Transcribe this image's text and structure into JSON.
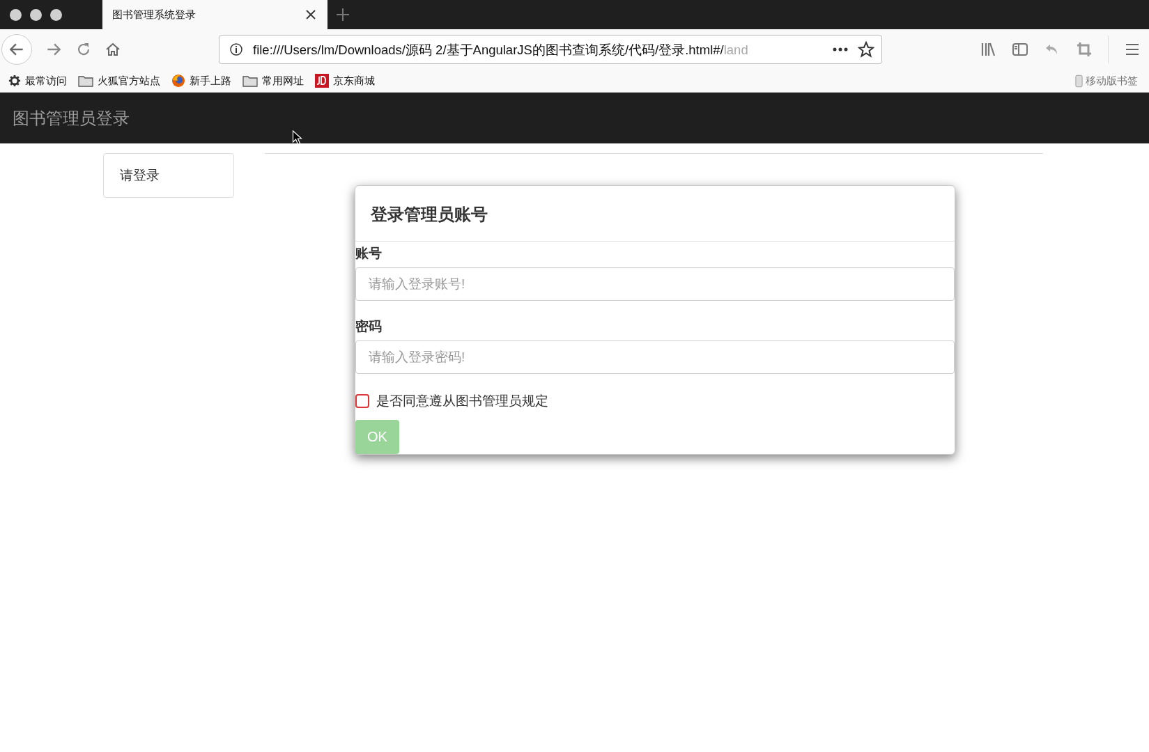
{
  "browser": {
    "tab": {
      "title": "图书管理系统登录",
      "selected": true
    },
    "url": {
      "main": "file:///Users/lm/Downloads/源码 2/基于AngularJS的图书查询系统/代码/登录.html#/",
      "faded": "land"
    },
    "bookmarks": [
      {
        "kind": "gear",
        "label": "最常访问"
      },
      {
        "kind": "folder",
        "label": "火狐官方站点"
      },
      {
        "kind": "firefox",
        "label": "新手上路"
      },
      {
        "kind": "folder",
        "label": "常用网址"
      },
      {
        "kind": "jd",
        "label": "京东商城"
      }
    ],
    "mobile_bookmarks": "移动版书签"
  },
  "navbar": {
    "brand": "图书管理员登录"
  },
  "sidebar": {
    "items": [
      {
        "label": "请登录"
      }
    ]
  },
  "dialog": {
    "title": "登录管理员账号",
    "fields": [
      {
        "label": "账号",
        "placeholder": "请输入登录账号!"
      },
      {
        "label": "密码",
        "placeholder": "请输入登录密码!"
      }
    ],
    "agreement": {
      "label": "是否同意遵从图书管理员规定",
      "checked": false,
      "color": "#e03333"
    },
    "button": {
      "label": "OK",
      "disabled": true
    }
  }
}
